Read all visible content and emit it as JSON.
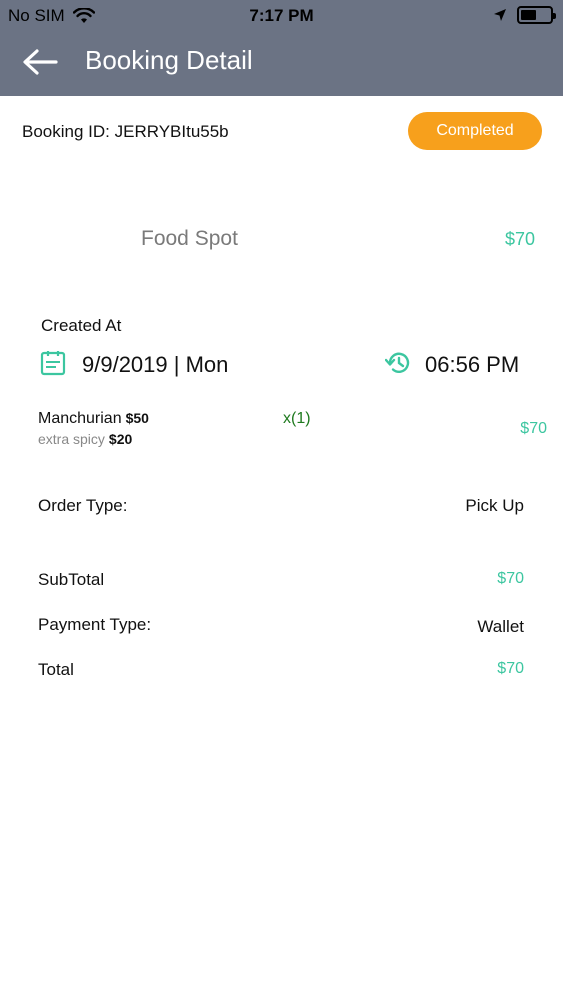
{
  "status_bar": {
    "carrier": "No SIM",
    "time": "7:17 PM",
    "battery_level": 0.55
  },
  "header": {
    "title": "Booking Detail",
    "back_icon": "arrow-left-icon"
  },
  "booking": {
    "id_text": "Booking ID: JERRYBItu55b",
    "status": "Completed",
    "status_color": "#f7a01c"
  },
  "restaurant": {
    "name": "Food Spot",
    "price": "$70"
  },
  "created": {
    "label": "Created At",
    "date": "9/9/2019 | Mon",
    "time": "06:56 PM"
  },
  "items": [
    {
      "name": "Manchurian",
      "price": "$50",
      "addon": "extra spicy",
      "addon_price": "$20",
      "quantity": "x(1)",
      "total": "$70"
    }
  ],
  "summary": {
    "order_type_label": "Order Type:",
    "order_type_value": "Pick Up",
    "subtotal_label": "SubTotal",
    "subtotal_value": "$70",
    "payment_type_label": "Payment Type:",
    "payment_type_value": "Wallet",
    "total_label": "Total",
    "total_value": "$70"
  },
  "colors": {
    "header_bg": "#6b7384",
    "accent_green": "#3cc6a0",
    "quantity_green": "#1f7a1f"
  }
}
